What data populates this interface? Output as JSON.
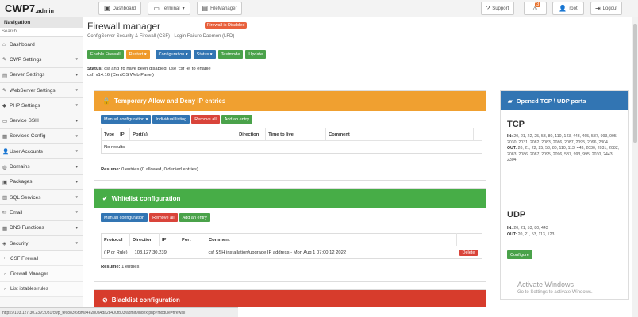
{
  "brand": {
    "name": "CWP7",
    "suffix": ".admin"
  },
  "topbar": {
    "dashboard": "Dashboard",
    "terminal": "Terminal",
    "filemanager": "FileManager",
    "support": "Support",
    "notif_count": "3",
    "user": "root",
    "logout": "Logout"
  },
  "sidebar": {
    "heading": "Navigation",
    "search_placeholder": "Search..",
    "items": [
      {
        "label": "Dashboard",
        "icon": "home-icon"
      },
      {
        "label": "CWP Settings",
        "icon": "wrench-icon"
      },
      {
        "label": "Server Settings",
        "icon": "server-icon"
      },
      {
        "label": "WebServer Settings",
        "icon": "wrench-icon"
      },
      {
        "label": "PHP Settings",
        "icon": "php-icon"
      },
      {
        "label": "Service SSH",
        "icon": "terminal-icon"
      },
      {
        "label": "Services Config",
        "icon": "config-icon"
      },
      {
        "label": "User Accounts",
        "icon": "user-icon"
      },
      {
        "label": "Domains",
        "icon": "globe-icon"
      },
      {
        "label": "Packages",
        "icon": "package-icon"
      },
      {
        "label": "SQL Services",
        "icon": "database-icon"
      },
      {
        "label": "Email",
        "icon": "email-icon"
      },
      {
        "label": "DNS Functions",
        "icon": "dns-icon"
      },
      {
        "label": "Security",
        "icon": "shield-icon"
      }
    ],
    "sub": [
      "CSF Firewall",
      "Firewall Manager",
      "List iptables rules"
    ]
  },
  "main": {
    "title": "Firewall manager",
    "fw_badge": "Firewall is Disabled",
    "subtitle": "ConfigServer Security & Firewall (CSF) - Login Failure Daemon (LFD)",
    "buttons": [
      "Enable Firewall",
      "Restart",
      "Configuration",
      "Status",
      "Testmode",
      "Update"
    ],
    "status_label": "Status:",
    "status_text": "csf and lfd have been disabled, use 'csf -e' to enable",
    "version": "csf: v14.16 (CentOS Web Panel)"
  },
  "temp_panel": {
    "title": "Temporary Allow and Deny IP entries",
    "buttons": [
      "Manual configuration",
      "Individual listing",
      "Remove all",
      "Add an entry"
    ],
    "headers": [
      "Type",
      "IP",
      "Port(s)",
      "Direction",
      "Time to live",
      "Comment"
    ],
    "empty": "No results",
    "resume_label": "Resume:",
    "resume": "0 entries (0 allowed, 0 denied entries)"
  },
  "white_panel": {
    "title": "Whitelist configuration",
    "buttons": [
      "Manual configuration",
      "Remove all",
      "Add an entry"
    ],
    "headers": [
      "Protocol",
      "Direction",
      "IP",
      "Port",
      "Comment"
    ],
    "row": {
      "proto": "(IP or Rule)",
      "ip": "103.127.30.239",
      "comment": "csf SSH installation/upgrade IP address - Mon Aug 1 07:00:12 2022",
      "delete": "Delete"
    },
    "resume_label": "Resume:",
    "resume": "1 entries"
  },
  "black_panel": {
    "title": "Blacklist configuration"
  },
  "ports": {
    "title": "Opened TCP \\ UDP ports",
    "tcp_h": "TCP",
    "in_label": "IN:",
    "out_label": "OUT:",
    "tcp_in": "20, 21, 22, 25, 53, 80, 110, 143, 443, 465, 587, 993, 995, 2030, 2031, 2082, 2083, 2086, 2087, 2095, 2096, 2304",
    "tcp_out": "20, 21, 22, 25, 53, 80, 110, 113, 443, 2030, 2031, 2082, 2083, 2086, 2087, 2095, 2096, 587, 993, 995, 2030, 2443, 2304",
    "udp_h": "UDP",
    "udp_in": "20, 21, 53, 80, 443",
    "udp_out": "20, 21, 53, 113, 123",
    "configure": "Configure"
  },
  "statusbar": "https://103.127.30.239:2031/cwp_fe6883f6f3f0a4e2b0a4da28400fb03/admin/index.php?module=firewall",
  "watermark": {
    "title": "Activate Windows",
    "sub": "Go to Settings to activate Windows."
  }
}
